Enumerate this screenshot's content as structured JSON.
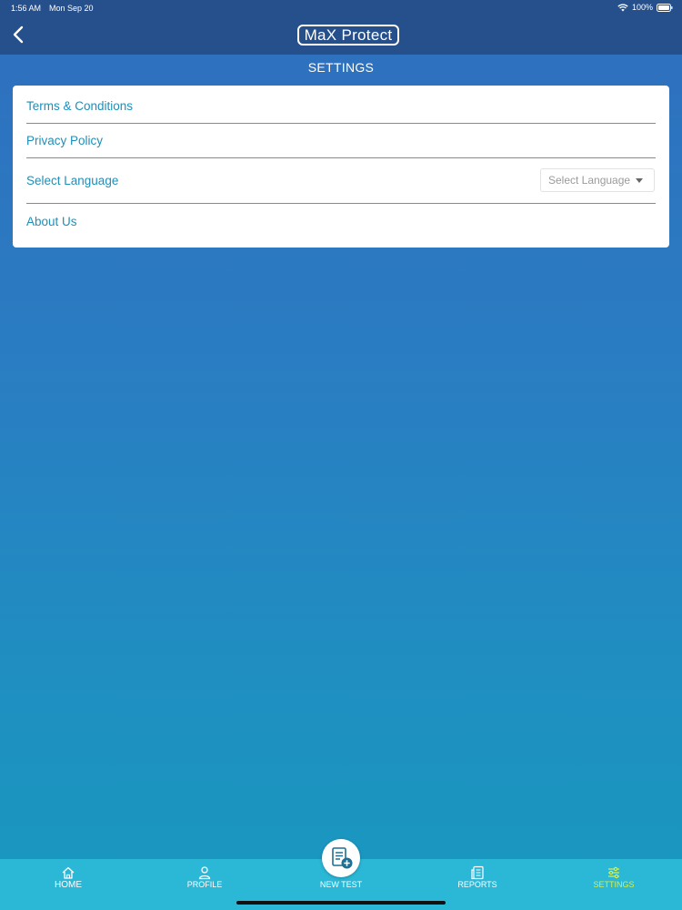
{
  "status_bar": {
    "time": "1:56 AM",
    "date": "Mon Sep 20",
    "battery": "100%"
  },
  "header": {
    "logo": "MaX Protect",
    "back_icon": "chevron-left-icon"
  },
  "page": {
    "title": "SETTINGS"
  },
  "settings": {
    "items": [
      {
        "label": "Terms & Conditions"
      },
      {
        "label": "Privacy Policy"
      },
      {
        "label": "Select Language"
      },
      {
        "label": "About Us"
      }
    ],
    "language_select": {
      "selected": "Select Language"
    }
  },
  "tabbar": {
    "items": [
      {
        "label": "HOME",
        "icon": "home-icon"
      },
      {
        "label": "PROFILE",
        "icon": "user-icon"
      },
      {
        "label": "NEW TEST",
        "icon": "document-add-icon"
      },
      {
        "label": "REPORTS",
        "icon": "reports-icon"
      },
      {
        "label": "SETTINGS",
        "icon": "sliders-icon"
      }
    ],
    "active": "SETTINGS"
  },
  "colors": {
    "header_bg": "#26508c",
    "tabbar_bg": "#2bb7d6",
    "accent": "#1f8fb8",
    "active_tab": "#d6f04a"
  }
}
